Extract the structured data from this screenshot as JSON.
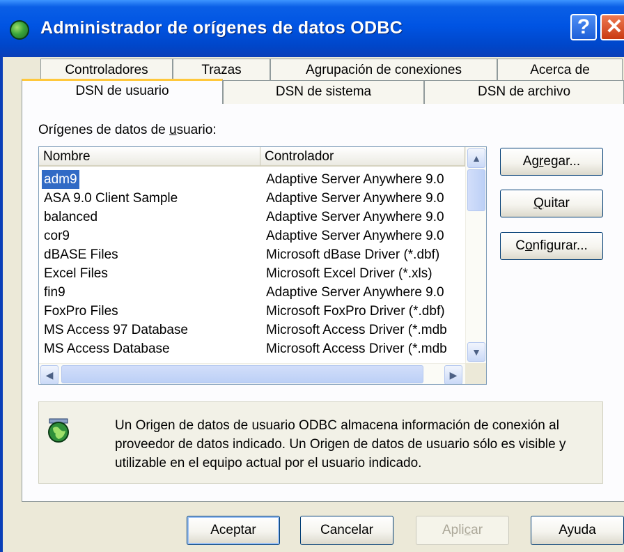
{
  "window": {
    "title": "Administrador de orígenes de datos ODBC",
    "help_button": "?",
    "close_button": "✕"
  },
  "tabs": {
    "row1": [
      "Controladores",
      "Trazas",
      "Agrupación de conexiones",
      "Acerca de"
    ],
    "row2": [
      "DSN de usuario",
      "DSN de sistema",
      "DSN de archivo"
    ],
    "active": "DSN de usuario"
  },
  "list": {
    "label_before": "Orígenes de datos de ",
    "label_mnemonic": "u",
    "label_after": "suario:",
    "columns": [
      "Nombre",
      "Controlador"
    ],
    "rows": [
      {
        "name": "adm9",
        "driver": "Adaptive Server Anywhere 9.0"
      },
      {
        "name": "ASA 9.0 Client Sample",
        "driver": "Adaptive Server Anywhere 9.0"
      },
      {
        "name": "balanced",
        "driver": "Adaptive Server Anywhere 9.0"
      },
      {
        "name": "cor9",
        "driver": "Adaptive Server Anywhere 9.0"
      },
      {
        "name": "dBASE Files",
        "driver": "Microsoft dBase Driver (*.dbf)"
      },
      {
        "name": "Excel Files",
        "driver": "Microsoft Excel Driver (*.xls)"
      },
      {
        "name": "fin9",
        "driver": "Adaptive Server Anywhere 9.0"
      },
      {
        "name": "FoxPro Files",
        "driver": "Microsoft FoxPro Driver (*.dbf)"
      },
      {
        "name": "MS Access 97 Database",
        "driver": "Microsoft Access Driver (*.mdb"
      },
      {
        "name": "MS Access Database",
        "driver": "Microsoft Access Driver (*.mdb"
      }
    ],
    "selected_index": 0
  },
  "side_buttons": {
    "add": {
      "before": "Ag",
      "mnemonic": "r",
      "after": "egar..."
    },
    "remove": {
      "before": "",
      "mnemonic": "Q",
      "after": "uitar"
    },
    "configure": {
      "before": "C",
      "mnemonic": "o",
      "after": "nfigurar..."
    }
  },
  "info": {
    "text": "Un Origen de datos de usuario ODBC almacena información de conexión al proveedor de datos indicado. Un Origen de datos de usuario sólo es visible y utilizable en el equipo actual por el usuario indicado."
  },
  "footer": {
    "ok": "Aceptar",
    "cancel": "Cancelar",
    "apply_before": "Apli",
    "apply_mnemonic": "c",
    "apply_after": "ar",
    "help": "Ayuda"
  },
  "colors": {
    "selection": "#316ac5",
    "titlebar": "#0054e3",
    "window_bg": "#ece9d8"
  }
}
